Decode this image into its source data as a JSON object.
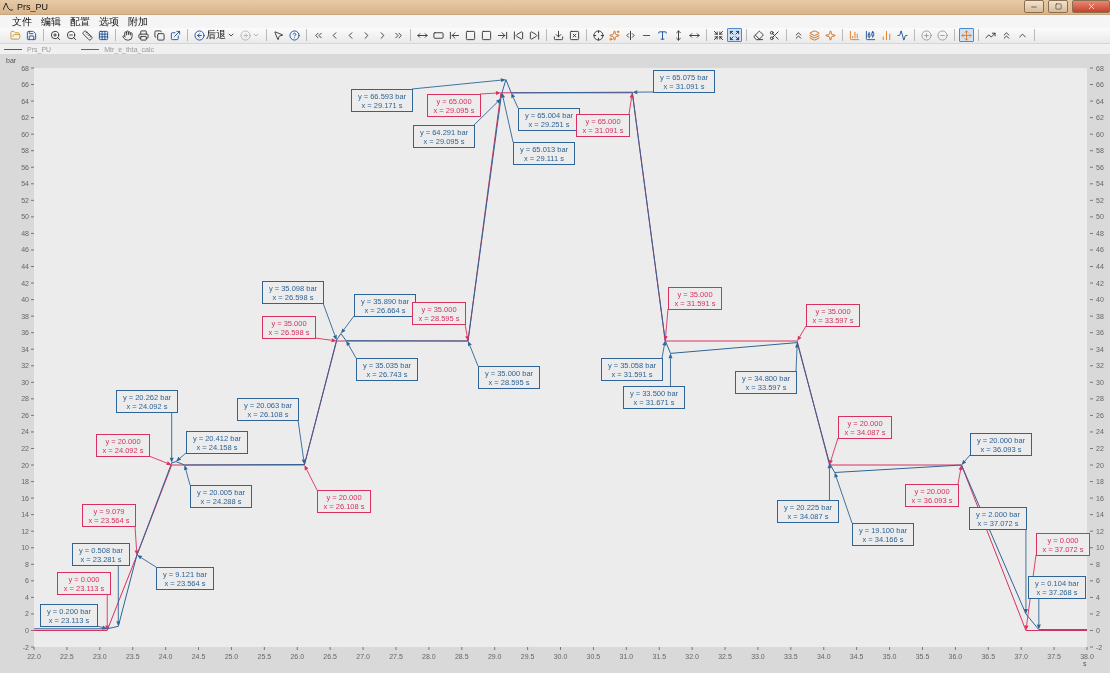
{
  "window": {
    "title": "Prs_PU"
  },
  "menu": [
    {
      "label": "文件"
    },
    {
      "label": "编辑"
    },
    {
      "label": "配置"
    },
    {
      "label": "选项"
    },
    {
      "label": "附加"
    }
  ],
  "toolbar": {
    "back_label": "后退",
    "forward_disabled": true,
    "toggles": [
      {
        "selected": false
      },
      {
        "selected": true
      },
      {
        "selected": true
      }
    ]
  },
  "chart": {
    "chart_data": {
      "type": "line",
      "xlabel": "s",
      "ylabel": "bar",
      "x": [
        22.0,
        23.113,
        23.281,
        23.564,
        24.092,
        24.158,
        24.288,
        26.108,
        26.598,
        26.664,
        26.743,
        28.595,
        29.095,
        29.111,
        29.171,
        29.251,
        31.091,
        31.591,
        31.671,
        33.597,
        34.087,
        34.166,
        36.093,
        37.072,
        37.268,
        38.0
      ],
      "series": [
        {
          "name": "Prs_PU",
          "color": "#2f6496",
          "values": [
            0.2,
            0.2,
            0.508,
            9.121,
            20.262,
            20.412,
            20.005,
            20.063,
            35.098,
            35.89,
            35.035,
            35.0,
            64.291,
            65.013,
            66.593,
            65.004,
            65.075,
            35.058,
            33.5,
            34.8,
            20.225,
            19.1,
            20.0,
            2.0,
            0.104,
            0.1
          ]
        },
        {
          "name": "Mtr_e_thta_calc",
          "color": "#d9305f",
          "values": [
            0,
            0,
            3.43,
            9.079,
            20,
            20,
            20,
            20,
            35,
            35,
            35,
            35,
            65,
            65,
            65,
            65,
            65,
            35,
            35,
            35,
            20,
            20,
            20,
            0,
            0,
            0
          ]
        }
      ],
      "xlim": [
        22,
        38
      ],
      "ylim": [
        -2,
        68
      ],
      "xticks": [
        {
          "value": 22,
          "label": "22.0"
        },
        {
          "value": 22.5,
          "label": "22.5"
        },
        {
          "value": 23,
          "label": "23.0"
        },
        {
          "value": 23.5,
          "label": "23.5"
        },
        {
          "value": 24,
          "label": "24.0"
        },
        {
          "value": 24.5,
          "label": "24.5"
        },
        {
          "value": 25,
          "label": "25.0"
        },
        {
          "value": 25.5,
          "label": "25.5"
        },
        {
          "value": 26,
          "label": "26.0"
        },
        {
          "value": 26.5,
          "label": "26.5"
        },
        {
          "value": 27,
          "label": "27.0"
        },
        {
          "value": 27.5,
          "label": "27.5"
        },
        {
          "value": 28,
          "label": "28.0"
        },
        {
          "value": 28.5,
          "label": "28.5"
        },
        {
          "value": 29,
          "label": "29.0"
        },
        {
          "value": 29.5,
          "label": "29.5"
        },
        {
          "value": 30,
          "label": "30.0"
        },
        {
          "value": 30.5,
          "label": "30.5"
        },
        {
          "value": 31,
          "label": "31.0"
        },
        {
          "value": 31.5,
          "label": "31.5"
        },
        {
          "value": 32,
          "label": "32.0"
        },
        {
          "value": 32.5,
          "label": "32.5"
        },
        {
          "value": 33,
          "label": "33.0"
        },
        {
          "value": 33.5,
          "label": "33.5"
        },
        {
          "value": 34,
          "label": "34.0"
        },
        {
          "value": 34.5,
          "label": "34.5"
        },
        {
          "value": 35,
          "label": "35.0"
        },
        {
          "value": 35.5,
          "label": "35.5"
        },
        {
          "value": 36,
          "label": "36.0"
        },
        {
          "value": 36.5,
          "label": "36.5"
        },
        {
          "value": 37,
          "label": "37.0"
        },
        {
          "value": 37.5,
          "label": "37.5"
        },
        {
          "value": 38,
          "label": "38.0"
        }
      ],
      "yticks": [
        -2,
        0,
        2,
        4,
        6,
        8,
        10,
        12,
        14,
        16,
        18,
        20,
        22,
        24,
        26,
        28,
        30,
        32,
        34,
        36,
        38,
        40,
        42,
        44,
        46,
        48,
        50,
        52,
        54,
        56,
        58,
        60,
        62,
        64,
        66,
        68
      ],
      "annotations": [
        {
          "text": "y = 66.593 bar\nx = 29.171 s",
          "x": 29.171,
          "y": 66.593
        },
        {
          "text": "y = 65.075 bar\nx = 31.091 s",
          "x": 31.091,
          "y": 65.075
        },
        {
          "text": "y = 65.000\nx = 29.095 s",
          "x": 29.095,
          "y": 65
        },
        {
          "text": "y = 65.004 bar\nx = 29.251 s",
          "x": 29.251,
          "y": 65.004
        },
        {
          "text": "y = 65.000\nx = 31.091 s",
          "x": 31.091,
          "y": 65
        },
        {
          "text": "y = 64.291 bar\nx = 29.095 s",
          "x": 29.095,
          "y": 64.291
        },
        {
          "text": "y = 65.013 bar\nx = 29.111 s",
          "x": 29.111,
          "y": 65.013
        },
        {
          "text": "y = 35.098 bar\nx = 26.598 s",
          "x": 26.598,
          "y": 35.098
        },
        {
          "text": "y = 35.000\nx = 31.591 s",
          "x": 31.591,
          "y": 35
        },
        {
          "text": "y = 35.890 bar\nx = 26.664 s",
          "x": 26.664,
          "y": 35.89
        },
        {
          "text": "y = 35.000\nx = 28.595 s",
          "x": 28.595,
          "y": 35
        },
        {
          "text": "y = 35.000\nx = 33.597 s",
          "x": 33.597,
          "y": 35
        },
        {
          "text": "y = 35.000\nx = 26.598 s",
          "x": 26.598,
          "y": 35
        },
        {
          "text": "y = 35.035 bar\nx = 26.743 s",
          "x": 26.743,
          "y": 35.035
        },
        {
          "text": "y = 35.058 bar\nx = 31.591 s",
          "x": 31.591,
          "y": 35.058
        },
        {
          "text": "y = 35.000 bar\nx = 28.595 s",
          "x": 28.595,
          "y": 35.0
        },
        {
          "text": "y = 34.800 bar\nx = 33.597 s",
          "x": 33.597,
          "y": 34.8
        },
        {
          "text": "y = 33.500 bar\nx = 31.671 s",
          "x": 31.671,
          "y": 33.5
        },
        {
          "text": "y = 20.262 bar\nx = 24.092 s",
          "x": 24.092,
          "y": 20.262
        },
        {
          "text": "y = 20.063 bar\nx = 26.108 s",
          "x": 26.108,
          "y": 20.063
        },
        {
          "text": "y = 20.000\nx = 34.087 s",
          "x": 34.087,
          "y": 20
        },
        {
          "text": "y = 20.412 bar\nx = 24.158 s",
          "x": 24.158,
          "y": 20.412
        },
        {
          "text": "y = 20.000\nx = 24.092 s",
          "x": 24.092,
          "y": 20
        },
        {
          "text": "y = 20.000 bar\nx = 36.093 s",
          "x": 36.093,
          "y": 20.0
        },
        {
          "text": "y = 20.005 bar\nx = 24.288 s",
          "x": 24.288,
          "y": 20.005
        },
        {
          "text": "y = 20.000\nx = 36.093 s",
          "x": 36.093,
          "y": 20
        },
        {
          "text": "y = 20.000\nx = 26.108 s",
          "x": 26.108,
          "y": 20
        },
        {
          "text": "y = 20.225 bar\nx = 34.087 s",
          "x": 34.087,
          "y": 20.225
        },
        {
          "text": "y = 9.079\nx = 23.564 s",
          "x": 23.564,
          "y": 9.079
        },
        {
          "text": "y = 2.000 bar\nx = 37.072 s",
          "x": 37.072,
          "y": 2.0
        },
        {
          "text": "y = 19.100 bar\nx = 34.166 s",
          "x": 34.166,
          "y": 19.1
        },
        {
          "text": "y = 0.000\nx = 37.072 s",
          "x": 37.072,
          "y": 0
        },
        {
          "text": "y = 0.508 bar\nx = 23.281 s",
          "x": 23.281,
          "y": 0.508
        },
        {
          "text": "y = 9.121 bar\nx = 23.564 s",
          "x": 23.564,
          "y": 9.121
        },
        {
          "text": "y = 0.000\nx = 23.113 s",
          "x": 23.113,
          "y": 0
        },
        {
          "text": "y = 0.104 bar\nx = 37.268 s",
          "x": 37.268,
          "y": 0.104
        },
        {
          "text": "y = 0.200 bar\nx = 23.113 s",
          "x": 23.113,
          "y": 0.2
        }
      ]
    },
    "callouts": [
      {
        "color": "#2f6496"
      },
      {
        "color": "#2f6496"
      },
      {
        "color": "#d9305f"
      },
      {
        "color": "#2f6496"
      },
      {
        "color": "#d9305f"
      },
      {
        "color": "#2f6496"
      },
      {
        "color": "#2f6496"
      },
      {
        "color": "#2f6496"
      },
      {
        "color": "#d9305f"
      },
      {
        "color": "#2f6496"
      },
      {
        "color": "#d9305f"
      },
      {
        "color": "#d9305f"
      },
      {
        "color": "#d9305f"
      },
      {
        "color": "#2f6496"
      },
      {
        "color": "#2f6496"
      },
      {
        "color": "#2f6496"
      },
      {
        "color": "#2f6496"
      },
      {
        "color": "#2f6496"
      },
      {
        "color": "#2f6496"
      },
      {
        "color": "#2f6496"
      },
      {
        "color": "#d9305f"
      },
      {
        "color": "#2f6496"
      },
      {
        "color": "#d9305f"
      },
      {
        "color": "#2f6496"
      },
      {
        "color": "#2f6496"
      },
      {
        "color": "#d9305f"
      },
      {
        "color": "#d9305f"
      },
      {
        "color": "#2f6496"
      },
      {
        "color": "#d9305f"
      },
      {
        "color": "#2f6496"
      },
      {
        "color": "#2f6496"
      },
      {
        "color": "#d9305f"
      },
      {
        "color": "#2f6496"
      },
      {
        "color": "#2f6496"
      },
      {
        "color": "#d9305f"
      },
      {
        "color": "#2f6496"
      },
      {
        "color": "#2f6496"
      }
    ],
    "right_axis": {
      "labels": [
        "68",
        "66",
        "64",
        "62",
        "60",
        "58",
        "56",
        "54",
        "52",
        "50",
        "48",
        "46",
        "44",
        "42",
        "40",
        "38",
        "36",
        "34",
        "32",
        "30",
        "28",
        "26",
        "24",
        "22",
        "20",
        "18",
        "16",
        "14",
        "12",
        "10",
        "8",
        "6",
        "4",
        "2",
        "0",
        "-2"
      ]
    }
  }
}
